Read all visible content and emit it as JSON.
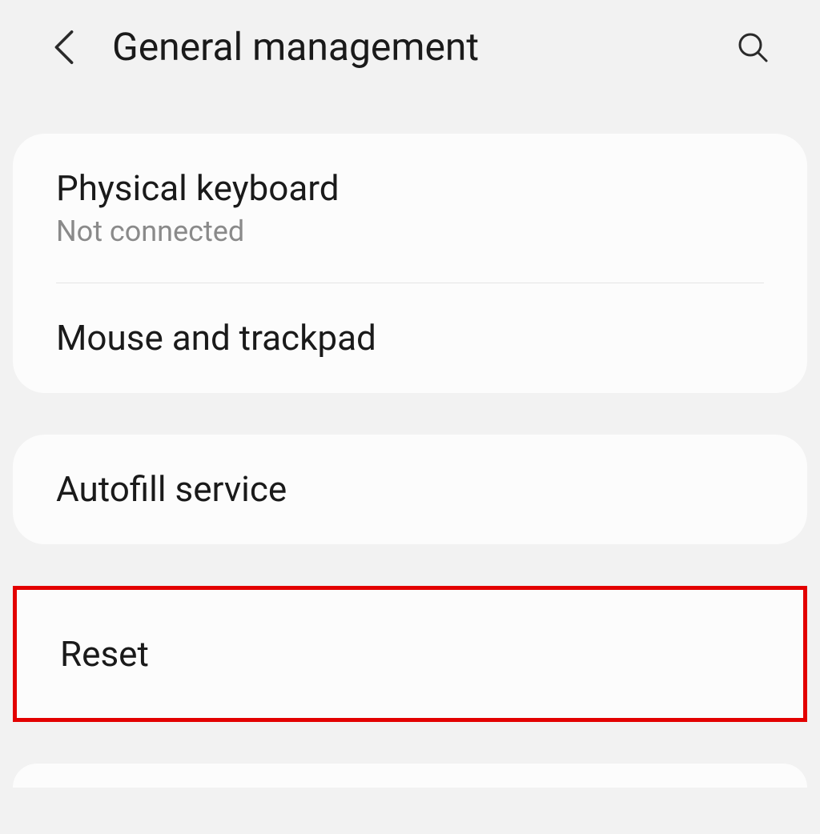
{
  "header": {
    "title": "General management"
  },
  "section1": {
    "items": [
      {
        "title": "Physical keyboard",
        "subtitle": "Not connected"
      },
      {
        "title": "Mouse and trackpad"
      }
    ]
  },
  "section2": {
    "items": [
      {
        "title": "Autofill service"
      }
    ]
  },
  "section3": {
    "items": [
      {
        "title": "Reset"
      }
    ]
  }
}
